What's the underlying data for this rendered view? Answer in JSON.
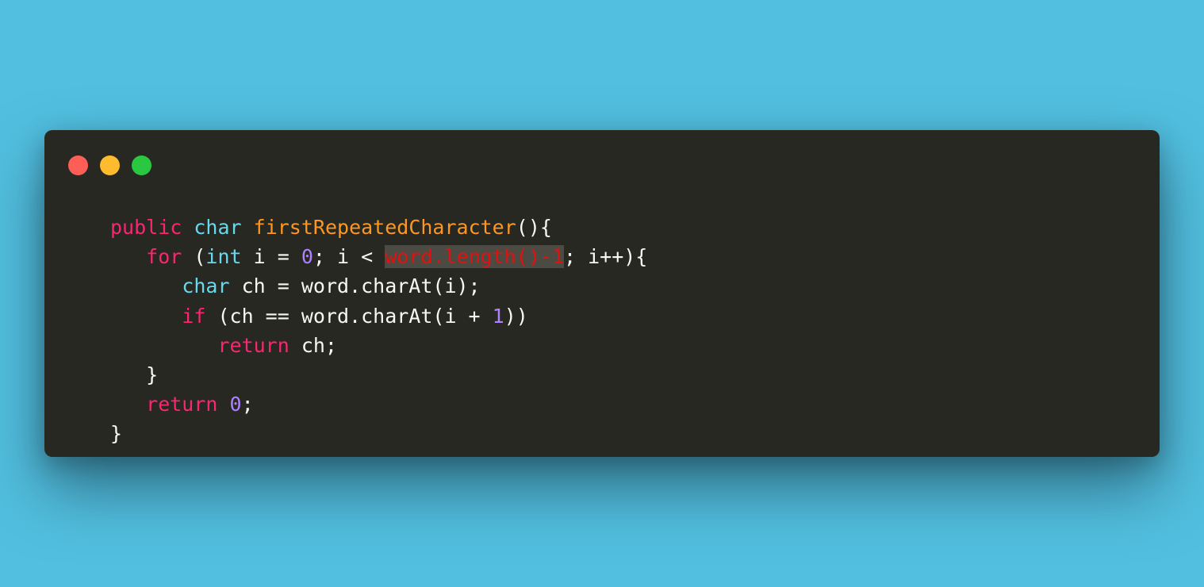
{
  "window": {
    "controls": {
      "close_color": "#fd5f57",
      "minimize_color": "#febb2e",
      "maximize_color": "#29c840"
    }
  },
  "colors": {
    "background": "#52bfe0",
    "editor": "#282823",
    "keyword": "#f92672",
    "type": "#66d9ef",
    "function": "#fd971f",
    "number": "#ae81ff",
    "error_highlight": "#e0120f"
  },
  "code": {
    "line1": {
      "kw_public": "public",
      "type_char": "char",
      "fn_name": "firstRepeatedCharacter",
      "punct": "(){"
    },
    "line2": {
      "kw_for": "for",
      "open": " (",
      "type_int": "int",
      "decl": " i = ",
      "zero": "0",
      "cond": "; i < ",
      "highlighted": "word.length()-1",
      "rest": "; i++){"
    },
    "line3": {
      "type_char": "char",
      "rest": " ch = word.charAt(i);"
    },
    "line4": {
      "kw_if": "if",
      "cond": " (ch == word.charAt(i + ",
      "one": "1",
      "close": "))"
    },
    "line5": {
      "kw_return": "return",
      "rest": " ch;"
    },
    "line6": {
      "brace": "}"
    },
    "line7": {
      "kw_return": "return",
      "space": " ",
      "zero": "0",
      "semi": ";"
    },
    "line8": {
      "brace": "}"
    }
  }
}
